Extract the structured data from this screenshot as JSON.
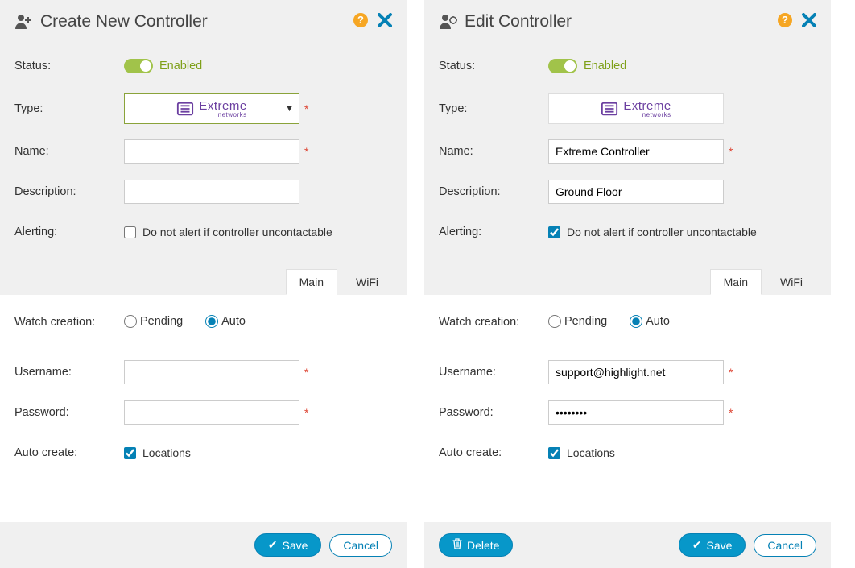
{
  "create": {
    "title": "Create New Controller",
    "fields": {
      "status_label": "Status:",
      "status_value": "Enabled",
      "type_label": "Type:",
      "type_logo_main": "Extreme",
      "type_logo_sub": "networks",
      "name_label": "Name:",
      "name_value": "",
      "description_label": "Description:",
      "description_value": "",
      "alerting_label": "Alerting:",
      "alerting_checkbox": "Do not alert if controller uncontactable",
      "watch_label": "Watch creation:",
      "radio_pending": "Pending",
      "radio_auto": "Auto",
      "username_label": "Username:",
      "username_value": "",
      "password_label": "Password:",
      "password_value": "",
      "autocreate_label": "Auto create:",
      "autocreate_checkbox": "Locations"
    },
    "tabs": {
      "main": "Main",
      "wifi": "WiFi"
    },
    "buttons": {
      "save": "Save",
      "cancel": "Cancel"
    }
  },
  "edit": {
    "title": "Edit Controller",
    "fields": {
      "status_label": "Status:",
      "status_value": "Enabled",
      "type_label": "Type:",
      "type_logo_main": "Extreme",
      "type_logo_sub": "networks",
      "name_label": "Name:",
      "name_value": "Extreme Controller",
      "description_label": "Description:",
      "description_value": "Ground Floor",
      "alerting_label": "Alerting:",
      "alerting_checkbox": "Do not alert if controller uncontactable",
      "watch_label": "Watch creation:",
      "radio_pending": "Pending",
      "radio_auto": "Auto",
      "username_label": "Username:",
      "username_value": "support@highlight.net",
      "password_label": "Password:",
      "password_value": "••••••••",
      "autocreate_label": "Auto create:",
      "autocreate_checkbox": "Locations"
    },
    "tabs": {
      "main": "Main",
      "wifi": "WiFi"
    },
    "buttons": {
      "delete": "Delete",
      "save": "Save",
      "cancel": "Cancel"
    }
  }
}
